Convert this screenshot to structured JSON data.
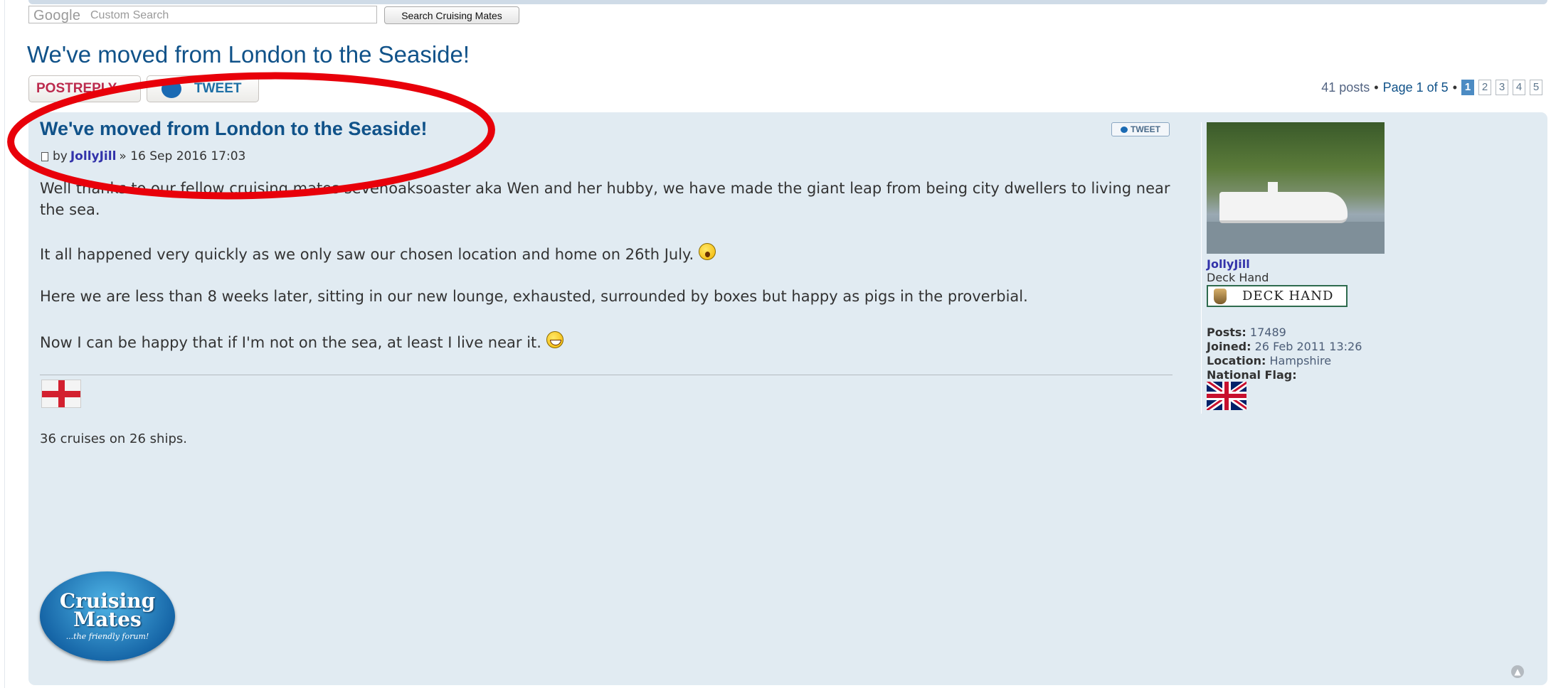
{
  "search": {
    "brand": "Google",
    "placeholder": "Custom Search",
    "button_label": "Search Cruising Mates"
  },
  "topic": {
    "title": "We've moved from London to the Seaside!"
  },
  "actions": {
    "postreply_label": "POSTREPLY",
    "tweet_label": "TWEET"
  },
  "pagination": {
    "count": "41 posts",
    "separator": "•",
    "page_label": "Page 1 of 5",
    "pages": [
      "1",
      "2",
      "3",
      "4",
      "5"
    ],
    "current": "1"
  },
  "post": {
    "title": "We've moved from London to the Seaside!",
    "by": "by",
    "author": "JollyJill",
    "date": "» 16 Sep 2016 17:03",
    "tweet_label": "TWEET",
    "paragraphs": [
      "Well thanks to our fellow cruising mates sevenoaksoaster aka Wen and her hubby, we have made the giant leap from being city dwellers to living near the sea.",
      "It all happened very quickly as we only saw our chosen location and home on 26th July.",
      "Here we are less than 8 weeks later, sitting in our new lounge, exhausted, surrounded by boxes but happy as pigs in the proverbial.",
      "Now I can be happy that if I'm not on the sea, at least I live near it."
    ],
    "signature": "36 cruises on 26 ships."
  },
  "logo": {
    "line1": "Cruising",
    "line2": "Mates",
    "tagline": "...the friendly forum!"
  },
  "profile": {
    "name": "JollyJill",
    "rank": "Deck Hand",
    "rank_badge": "DECK HAND",
    "posts_label": "Posts:",
    "posts": "17489",
    "joined_label": "Joined:",
    "joined": "26 Feb 2011 13:26",
    "location_label": "Location:",
    "location": "Hampshire",
    "flag_label": "National Flag:"
  },
  "colors": {
    "panel_bg": "#e1ebf2",
    "title_blue": "#105289",
    "author_purple": "#3333aa",
    "annotation_red": "#e8000a"
  },
  "icons": [
    "document-icon",
    "tweet-bird-icon",
    "shocked-smiley-icon",
    "grin-smiley-icon",
    "england-flag-icon",
    "uk-flag-icon",
    "rank-badge-icon",
    "back-to-top-icon"
  ]
}
